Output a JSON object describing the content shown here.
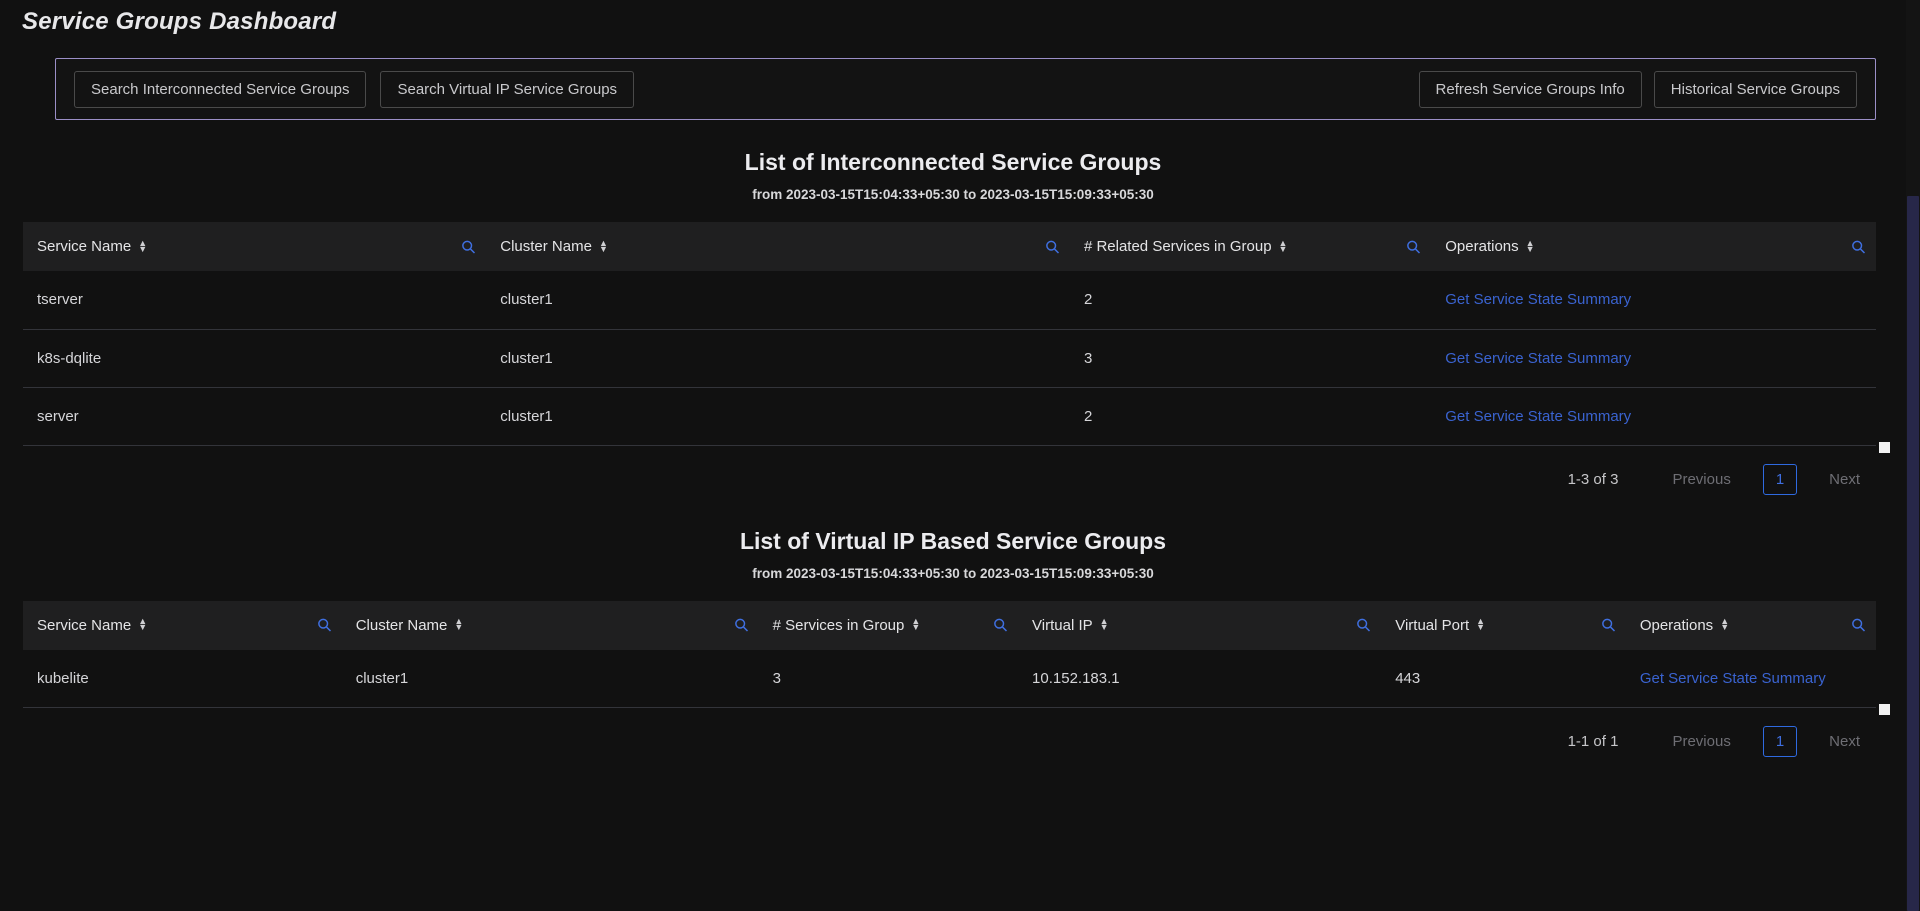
{
  "header": {
    "title": "Service Groups Dashboard"
  },
  "toolbar": {
    "left_buttons": [
      {
        "label": "Search Interconnected Service Groups",
        "name": "search-interconnected-service-groups-button"
      },
      {
        "label": "Search Virtual IP Service Groups",
        "name": "search-virtual-ip-service-groups-button"
      }
    ],
    "right_buttons": [
      {
        "label": "Refresh Service Groups Info",
        "name": "refresh-service-groups-info-button"
      },
      {
        "label": "Historical Service Groups",
        "name": "historical-service-groups-button"
      }
    ],
    "border_color": "#9b8fc7"
  },
  "colors": {
    "page_bg": "#111111",
    "header_row_bg": "#1f1f20",
    "link_blue": "#3a63d0",
    "icon_blue": "#3f6fe0",
    "row_divider": "#33343a",
    "scrollbar_thumb": "#272749"
  },
  "sections": [
    {
      "id": "interconnected",
      "title": "List of Interconnected Service Groups",
      "subtitle": "from 2023-03-15T15:04:33+05:30 to 2023-03-15T15:09:33+05:30",
      "columns": [
        {
          "label": "Service Name",
          "sort_icon": "sort-updown-icon",
          "search_icon": "search-icon"
        },
        {
          "label": "Cluster Name",
          "sort_icon": "sort-updown-icon",
          "search_icon": "search-icon"
        },
        {
          "label": "# Related Services in Group",
          "sort_icon": "sort-updown-icon",
          "search_icon": "search-icon"
        },
        {
          "label": "Operations",
          "sort_icon": "sort-updown-icon",
          "search_icon": "search-icon"
        }
      ],
      "rows": [
        {
          "service_name": "tserver",
          "cluster_name": "cluster1",
          "count": "2",
          "operation": "Get Service State Summary"
        },
        {
          "service_name": "k8s-dqlite",
          "cluster_name": "cluster1",
          "count": "3",
          "operation": "Get Service State Summary"
        },
        {
          "service_name": "server",
          "cluster_name": "cluster1",
          "count": "2",
          "operation": "Get Service State Summary"
        }
      ],
      "pagination": {
        "count_label": "1-3 of 3",
        "previous_label": "Previous",
        "current_page": "1",
        "next_label": "Next"
      }
    },
    {
      "id": "virtual-ip",
      "title": "List of Virtual IP Based Service Groups",
      "subtitle": "from 2023-03-15T15:04:33+05:30 to 2023-03-15T15:09:33+05:30",
      "columns": [
        {
          "label": "Service Name",
          "sort_icon": "sort-updown-icon",
          "search_icon": "search-icon"
        },
        {
          "label": "Cluster Name",
          "sort_icon": "sort-updown-icon",
          "search_icon": "search-icon"
        },
        {
          "label": "# Services in Group",
          "sort_icon": "sort-updown-icon",
          "search_icon": "search-icon"
        },
        {
          "label": "Virtual IP",
          "sort_icon": "sort-updown-icon",
          "search_icon": "search-icon"
        },
        {
          "label": "Virtual Port",
          "sort_icon": "sort-updown-icon",
          "search_icon": "search-icon"
        },
        {
          "label": "Operations",
          "sort_icon": "sort-updown-icon",
          "search_icon": "search-icon"
        }
      ],
      "rows": [
        {
          "service_name": "kubelite",
          "cluster_name": "cluster1",
          "count": "3",
          "virtual_ip": "10.152.183.1",
          "virtual_port": "443",
          "operation": "Get Service State Summary"
        }
      ],
      "pagination": {
        "count_label": "1-1 of 1",
        "previous_label": "Previous",
        "current_page": "1",
        "next_label": "Next"
      }
    }
  ]
}
